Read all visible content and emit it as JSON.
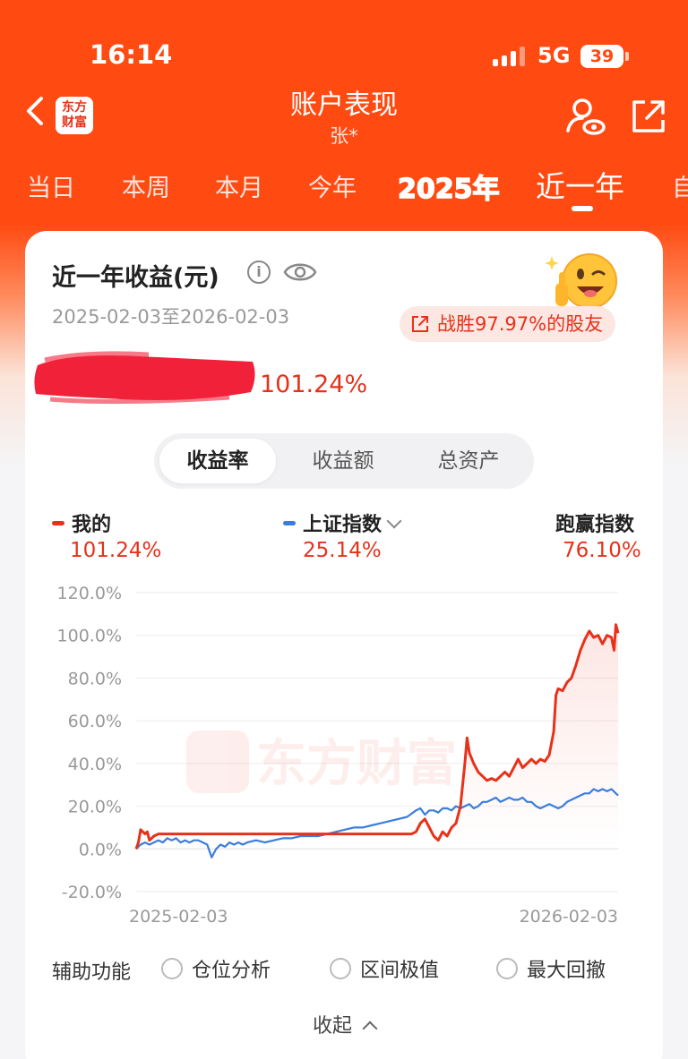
{
  "status": {
    "time": "16:14",
    "network": "5G",
    "battery": "39"
  },
  "nav": {
    "title": "账户表现",
    "subtitle": "张*",
    "logo_text": "东方\n财富"
  },
  "tabs": [
    {
      "label": "当日"
    },
    {
      "label": "本周"
    },
    {
      "label": "本月"
    },
    {
      "label": "今年"
    },
    {
      "label": "2025年"
    },
    {
      "label": "近一年"
    },
    {
      "label": "自"
    }
  ],
  "card": {
    "title": "近一年收益(元)",
    "date_range": "2025-02-03至2026-02-03",
    "beat_text": "战胜97.97%的股友",
    "return_rate": "101.24%"
  },
  "segments": [
    "收益率",
    "收益额",
    "总资产"
  ],
  "legend": {
    "mine": {
      "label": "我的",
      "value": "101.24%",
      "color": "#E8311A"
    },
    "index": {
      "label": "上证指数",
      "value": "25.14%",
      "color": "#3B7DDD"
    },
    "outperform": {
      "label": "跑赢指数",
      "value": "76.10%"
    }
  },
  "chart_data": {
    "type": "line",
    "x_start": "2025-02-03",
    "x_end": "2026-02-03",
    "x_tick_labels": [
      "2025-02-03",
      "2026-02-03"
    ],
    "y_ticks": [
      "120.0%",
      "100.0%",
      "80.0%",
      "60.0%",
      "40.0%",
      "20.0%",
      "0.0%",
      "-20.0%"
    ],
    "ylim": [
      -20,
      120
    ],
    "watermark": "东方财富",
    "series": [
      {
        "name": "我的",
        "color": "#E8311A",
        "points": [
          [
            0,
            0
          ],
          [
            0.5,
            3
          ],
          [
            1,
            9
          ],
          [
            2,
            7
          ],
          [
            2.5,
            8
          ],
          [
            3,
            4
          ],
          [
            4,
            6
          ],
          [
            5,
            7
          ],
          [
            8,
            7
          ],
          [
            15,
            7
          ],
          [
            25,
            7
          ],
          [
            35,
            7
          ],
          [
            45,
            7
          ],
          [
            55,
            7
          ],
          [
            62,
            7
          ],
          [
            63,
            8
          ],
          [
            64,
            12
          ],
          [
            65,
            14
          ],
          [
            66,
            10
          ],
          [
            67,
            6
          ],
          [
            68,
            4
          ],
          [
            69,
            8
          ],
          [
            70,
            6
          ],
          [
            71,
            10
          ],
          [
            72,
            12
          ],
          [
            73,
            20
          ],
          [
            74,
            40
          ],
          [
            74.5,
            52
          ],
          [
            75,
            45
          ],
          [
            76,
            40
          ],
          [
            77,
            36
          ],
          [
            78,
            34
          ],
          [
            79,
            32
          ],
          [
            80,
            33
          ],
          [
            81,
            32
          ],
          [
            82,
            34
          ],
          [
            83,
            36
          ],
          [
            84,
            34
          ],
          [
            85,
            38
          ],
          [
            86,
            42
          ],
          [
            87,
            38
          ],
          [
            88,
            40
          ],
          [
            89,
            42
          ],
          [
            90,
            40
          ],
          [
            91,
            42
          ],
          [
            92,
            41
          ],
          [
            93,
            44
          ],
          [
            94,
            55
          ],
          [
            94.5,
            72
          ],
          [
            95,
            75
          ],
          [
            96,
            74
          ],
          [
            97,
            78
          ],
          [
            98,
            80
          ],
          [
            99,
            86
          ],
          [
            100,
            93
          ],
          [
            101,
            98
          ],
          [
            102,
            102
          ],
          [
            103,
            99
          ],
          [
            104,
            100
          ],
          [
            105,
            96
          ],
          [
            106,
            100
          ],
          [
            107,
            99
          ],
          [
            107.6,
            93
          ],
          [
            108,
            105
          ],
          [
            108.5,
            101
          ]
        ]
      },
      {
        "name": "上证指数",
        "color": "#3B7DDD",
        "points": [
          [
            0,
            0
          ],
          [
            1,
            2
          ],
          [
            2,
            3
          ],
          [
            3,
            2
          ],
          [
            4,
            3
          ],
          [
            5,
            4
          ],
          [
            6,
            3
          ],
          [
            7,
            5
          ],
          [
            8,
            4
          ],
          [
            9,
            5
          ],
          [
            10,
            3
          ],
          [
            11,
            4
          ],
          [
            12,
            3
          ],
          [
            13,
            4
          ],
          [
            14,
            4
          ],
          [
            15,
            3
          ],
          [
            16,
            2
          ],
          [
            17,
            -4
          ],
          [
            18,
            0
          ],
          [
            19,
            2
          ],
          [
            20,
            1
          ],
          [
            21,
            3
          ],
          [
            22,
            2
          ],
          [
            23,
            3
          ],
          [
            24,
            2
          ],
          [
            25,
            3
          ],
          [
            27,
            4
          ],
          [
            29,
            3
          ],
          [
            31,
            4
          ],
          [
            33,
            5
          ],
          [
            35,
            5
          ],
          [
            37,
            6
          ],
          [
            39,
            6
          ],
          [
            41,
            6
          ],
          [
            43,
            7
          ],
          [
            45,
            8
          ],
          [
            47,
            9
          ],
          [
            49,
            10
          ],
          [
            51,
            10
          ],
          [
            53,
            11
          ],
          [
            55,
            12
          ],
          [
            57,
            13
          ],
          [
            59,
            14
          ],
          [
            61,
            15
          ],
          [
            63,
            18
          ],
          [
            64,
            19
          ],
          [
            65,
            16
          ],
          [
            66,
            18
          ],
          [
            67,
            18
          ],
          [
            68,
            17
          ],
          [
            69,
            19
          ],
          [
            70,
            19
          ],
          [
            71,
            18
          ],
          [
            72,
            20
          ],
          [
            73,
            19
          ],
          [
            74,
            20
          ],
          [
            75,
            21
          ],
          [
            76,
            19
          ],
          [
            77,
            20
          ],
          [
            78,
            22
          ],
          [
            79,
            22
          ],
          [
            80,
            23
          ],
          [
            81,
            24
          ],
          [
            82,
            22
          ],
          [
            83,
            23
          ],
          [
            84,
            24
          ],
          [
            85,
            23
          ],
          [
            86,
            23
          ],
          [
            87,
            24
          ],
          [
            88,
            22
          ],
          [
            89,
            22
          ],
          [
            90,
            20
          ],
          [
            91,
            19
          ],
          [
            92,
            20
          ],
          [
            93,
            21
          ],
          [
            94,
            20
          ],
          [
            95,
            19
          ],
          [
            96,
            20
          ],
          [
            97,
            22
          ],
          [
            98,
            23
          ],
          [
            99,
            24
          ],
          [
            100,
            25
          ],
          [
            101,
            26
          ],
          [
            102,
            26
          ],
          [
            103,
            28
          ],
          [
            104,
            27
          ],
          [
            105,
            28
          ],
          [
            106,
            27
          ],
          [
            107,
            28
          ],
          [
            108,
            26
          ],
          [
            108.5,
            25
          ]
        ]
      }
    ]
  },
  "aux": {
    "label": "辅助功能",
    "options": [
      "仓位分析",
      "区间极值",
      "最大回撤"
    ]
  },
  "collapse_label": "收起"
}
